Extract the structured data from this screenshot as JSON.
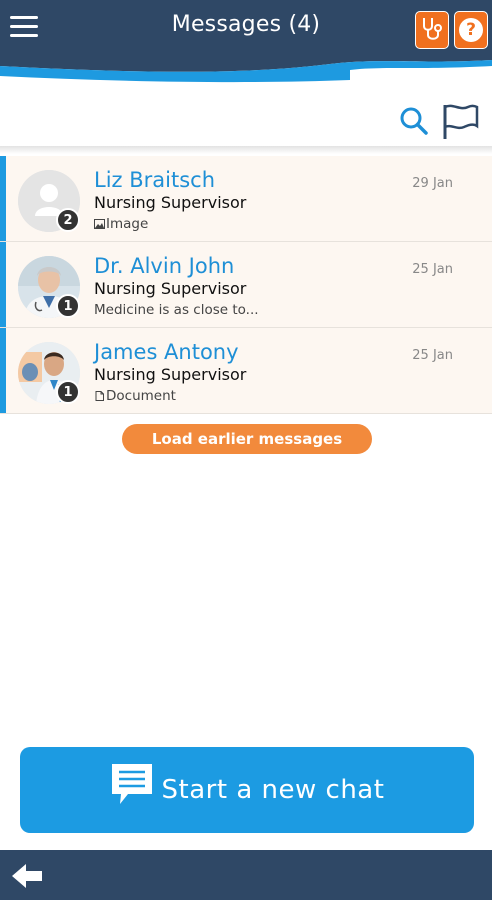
{
  "header": {
    "title": "Messages (4)",
    "menu_icon": "hamburger-menu-icon",
    "stethoscope_icon": "stethoscope-icon",
    "help_icon": "help-icon",
    "help_glyph": "?",
    "colors": {
      "navy": "#2f4866",
      "accent_blue": "#1e9ae0",
      "orange": "#f0701f"
    }
  },
  "toolbar": {
    "search_icon": "search-icon",
    "flag_icon": "flag-icon"
  },
  "conversations": [
    {
      "name": "Liz Braitsch",
      "role": "Nursing Supervisor",
      "preview": "Image",
      "preview_icon": "image-icon",
      "date": "29 Jan",
      "unread": "2",
      "avatar": "placeholder-avatar"
    },
    {
      "name": "Dr. Alvin John",
      "role": "Nursing Supervisor",
      "preview": "Medicine is as close to...",
      "preview_icon": "",
      "date": "25 Jan",
      "unread": "1",
      "avatar": "doctor-photo"
    },
    {
      "name": "James Antony",
      "role": "Nursing Supervisor",
      "preview": "Document",
      "preview_icon": "document-icon",
      "date": "25 Jan",
      "unread": "1",
      "avatar": "doctor-photo"
    }
  ],
  "load_earlier_label": "Load earlier messages",
  "new_chat": {
    "label": "Start a new chat",
    "icon": "chat-bubble-icon"
  },
  "bottom_bar": {
    "back_icon": "back-arrow-icon"
  }
}
